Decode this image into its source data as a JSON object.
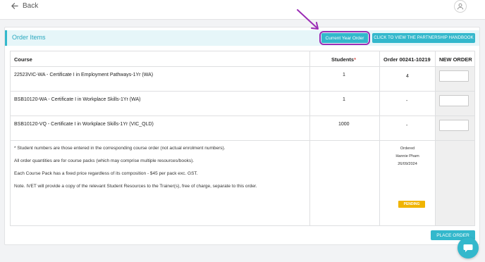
{
  "topbar": {
    "back_label": "Back"
  },
  "card": {
    "title": "Order Items",
    "current_year_label": "Current Year Order",
    "handbook_label": "CLICK TO VIEW THE PARTNERSHIP HANDBOOK"
  },
  "table": {
    "headers": {
      "course": "Course",
      "students": "Students",
      "students_required": "*",
      "order": "Order 00241-10219",
      "new_order": "NEW ORDER"
    },
    "rows": [
      {
        "course": "22523VIC-WA - Certificate I in Employment Pathways-1Yr (WA)",
        "students": "1",
        "order": "4"
      },
      {
        "course": "BSB10120-WA - Certificate I in Workplace Skills-1Yr (WA)",
        "students": "1",
        "order": "-"
      },
      {
        "course": "BSB10120-VQ - Certificate I in Workplace Skills-1Yr (VIC_QLD)",
        "students": "1000",
        "order": "-"
      }
    ],
    "notes": [
      "* Student numbers are those entered in the corresponding course order (not actual enrolment numbers).",
      "All order quantities are for course packs (which may comprise multiple resources/books).",
      "Each Course Pack has a fixed price regardless of its composition - $45 per pack exc. GST.",
      "Note. IVET will provide a copy of the relevant Student Resources to the Trainer(s), free of charge, separate to this order."
    ],
    "order_status": {
      "label": "Ordered",
      "by": "Hannie Pham",
      "date": "26/09/2024",
      "badge": "PENDING"
    }
  },
  "actions": {
    "place_order_label": "PLACE ORDER"
  },
  "colors": {
    "accent": "#33b8cc",
    "highlight": "#9b2db5",
    "pending": "#f0b400"
  },
  "icons": {
    "back": "arrow-left-icon",
    "user": "user-icon",
    "chat": "chat-icon",
    "annotation": "arrow-annotation-icon"
  }
}
